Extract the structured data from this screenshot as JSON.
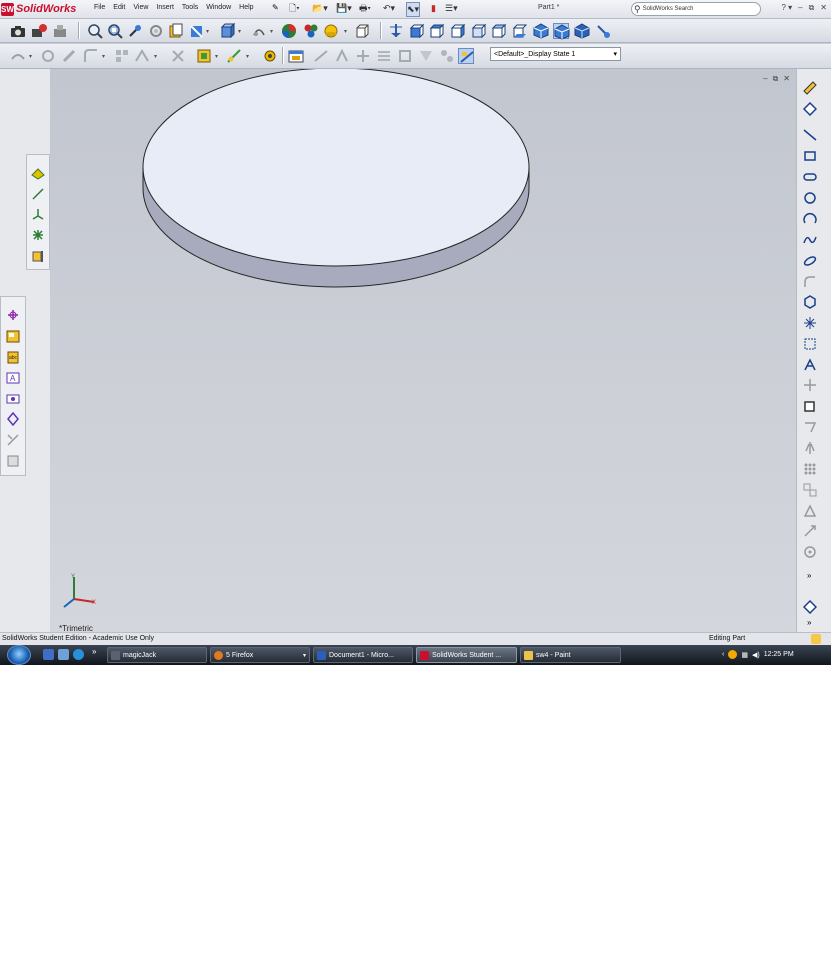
{
  "app": {
    "logo_text": "SolidWorks",
    "document_title": "Part1 *",
    "search_placeholder": "SolidWorks Search"
  },
  "menu": [
    "File",
    "Edit",
    "View",
    "Insert",
    "Tools",
    "Window",
    "Help"
  ],
  "toolbar2": {
    "display_state": "<Default>_Display State 1"
  },
  "viewport": {
    "view_name": "*Trimetric"
  },
  "status_bar": {
    "left_text": "SolidWorks Student Edition - Academic Use Only",
    "right_text": "Editing Part"
  },
  "taskbar": {
    "tasks": [
      {
        "label": "magicJack",
        "icon_color": "#5a6270"
      },
      {
        "label": "5 Firefox",
        "icon_color": "#e07a1f"
      },
      {
        "label": "Document1 - Micro...",
        "icon_color": "#2b5fb8"
      },
      {
        "label": "SolidWorks Student ...",
        "icon_color": "#c8102e"
      },
      {
        "label": "sw4 - Paint",
        "icon_color": "#e9c34a"
      }
    ],
    "clock": "12:25 PM"
  },
  "colors": {
    "accent": "#c8102e",
    "part_top": "#e8ecf6",
    "part_side": "#a8abbe"
  }
}
